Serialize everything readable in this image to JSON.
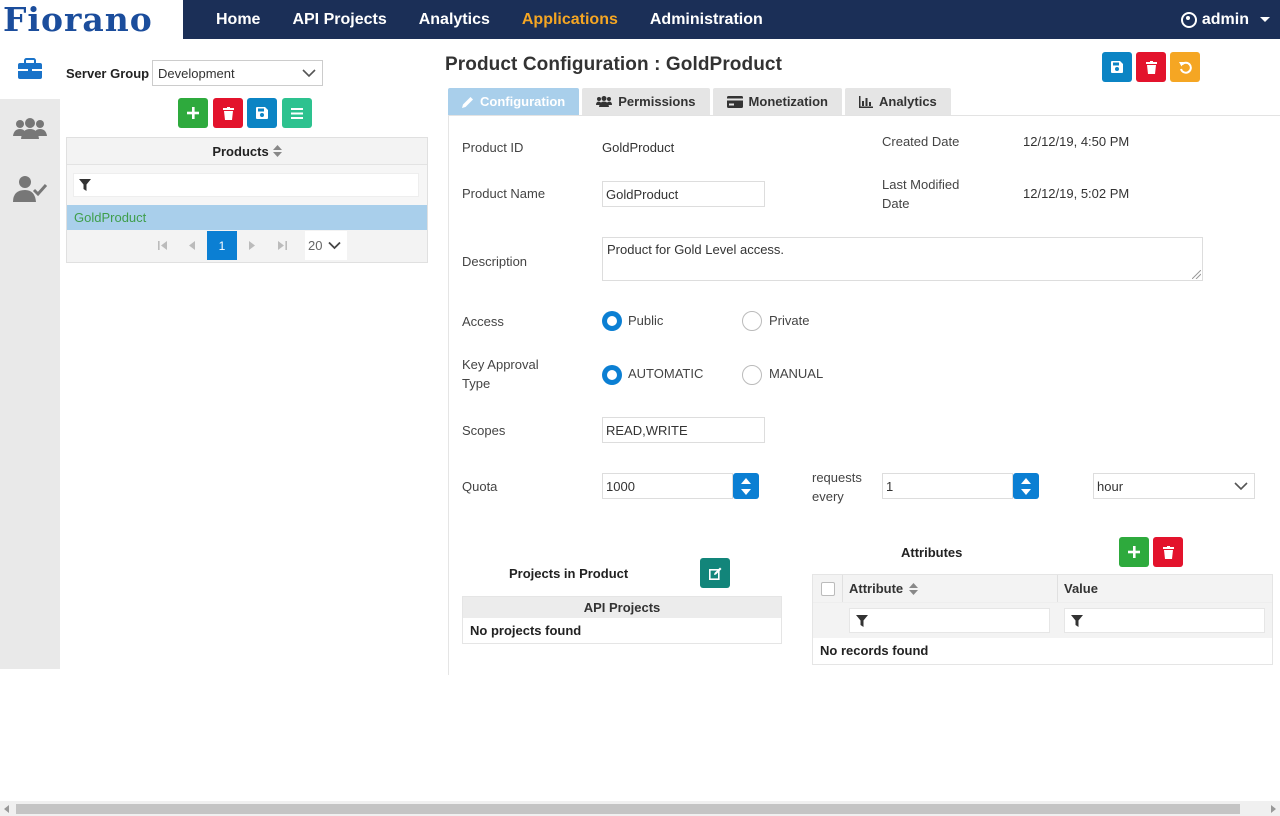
{
  "brand": {
    "logo": "Fiorano"
  },
  "nav": {
    "items": [
      {
        "label": "Home"
      },
      {
        "label": "API Projects"
      },
      {
        "label": "Analytics"
      },
      {
        "label": "Applications"
      },
      {
        "label": "Administration"
      }
    ],
    "active": "Applications",
    "active_color": "#f5a623",
    "user": "admin"
  },
  "rail": {
    "icons": [
      "briefcase-icon",
      "users-icon",
      "user-check-icon"
    ]
  },
  "left": {
    "server_group_label": "Server Group",
    "server_group_value": "Development",
    "products_header": "Products",
    "products": [
      "GoldProduct"
    ],
    "pager": {
      "current_page": "1",
      "page_size": "20"
    }
  },
  "main": {
    "title": "Product Configuration : GoldProduct",
    "tabs": [
      {
        "label": "Configuration"
      },
      {
        "label": "Permissions"
      },
      {
        "label": "Monetization"
      },
      {
        "label": "Analytics"
      }
    ],
    "fields": {
      "product_id_label": "Product ID",
      "product_id": "GoldProduct",
      "product_name_label": "Product Name",
      "product_name": "GoldProduct",
      "created_label": "Created Date",
      "created": "12/12/19, 4:50 PM",
      "modified_label_1": "Last Modified",
      "modified_label_2": "Date",
      "modified": "12/12/19, 5:02 PM",
      "description_label": "Description",
      "description": "Product for Gold Level access.",
      "access_label": "Access",
      "access_public": "Public",
      "access_private": "Private",
      "key_label_1": "Key Approval",
      "key_label_2": "Type",
      "key_automatic": "AUTOMATIC",
      "key_manual": "MANUAL",
      "scopes_label": "Scopes",
      "scopes": "READ,WRITE",
      "quota_label": "Quota",
      "quota": "1000",
      "requests_1": "requests",
      "requests_2": "every",
      "interval": "1",
      "unit": "hour"
    },
    "projects": {
      "title": "Projects in Product",
      "column": "API Projects",
      "empty": "No projects found"
    },
    "attributes": {
      "title": "Attributes",
      "columns": [
        "Attribute",
        "Value"
      ],
      "empty": "No records found"
    }
  },
  "colors": {
    "topbar": "#1b2f57",
    "accent_blue": "#0b7fd3",
    "green": "#2eaa3d",
    "red": "#e3132c",
    "orange": "#f5a623"
  }
}
